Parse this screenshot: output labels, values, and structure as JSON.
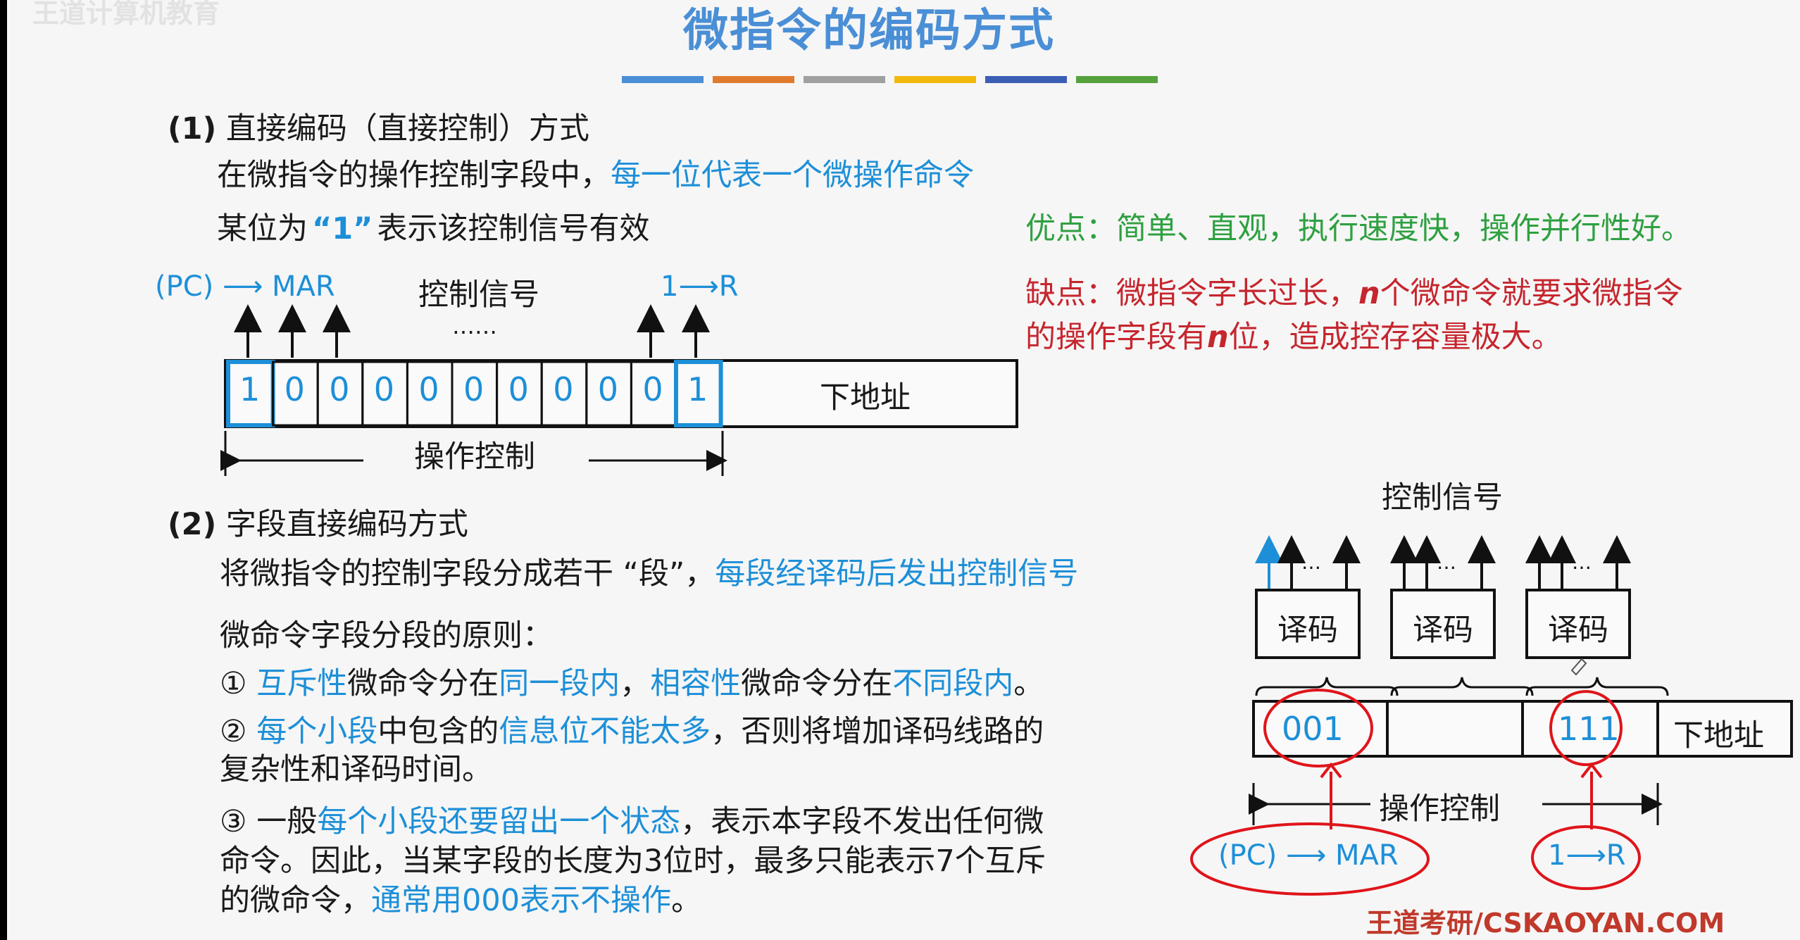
{
  "watermark": "王道计算机教育",
  "title": "微指令的编码方式",
  "title_bar_colors": [
    "#4a8fd6",
    "#e07b2e",
    "#a0a0a0",
    "#f2b90c",
    "#3c5fb5",
    "#55a23c"
  ],
  "section1": {
    "heading_num": "(1)",
    "heading": "直接编码（直接控制）方式",
    "line1_prefix": "在微指令的操作控制字段中，",
    "line1_highlight": "每一位代表一个微操作命令",
    "line2_a": "某位为",
    "line2_quote": "“1”",
    "line2_b": "表示该控制信号有效",
    "pros": "优点：简单、直观，执行速度快，操作并行性好。",
    "cons_a": "缺点：微指令字长过长，",
    "cons_n1": "n",
    "cons_b": "个微命令就要求微指令",
    "cons_c": "的操作字段有",
    "cons_n2": "n",
    "cons_d": "位，造成控存容量极大。"
  },
  "diagram1": {
    "pc_mar": "(PC) ⟶ MAR",
    "control_signal": "控制信号",
    "dots": "……",
    "one_r": "1⟶R",
    "bits": [
      "1",
      "0",
      "0",
      "0",
      "0",
      "0",
      "0",
      "0",
      "0",
      "0",
      "1"
    ],
    "next_address": "下地址",
    "operation_control": "操作控制"
  },
  "section2": {
    "heading_num": "(2)",
    "heading": "字段直接编码方式",
    "line1_prefix": "将微指令的控制字段分成若干 “段”，",
    "line1_highlight": "每段经译码后发出控制信号",
    "principle": "微命令字段分段的原则：",
    "p1": [
      {
        "text": "① ",
        "hl": false
      },
      {
        "text": "互斥性",
        "hl": true
      },
      {
        "text": "微命令分在",
        "hl": false
      },
      {
        "text": "同一段内",
        "hl": true
      },
      {
        "text": "，",
        "hl": false
      },
      {
        "text": "相容性",
        "hl": true
      },
      {
        "text": "微命令分在",
        "hl": false
      },
      {
        "text": "不同段内",
        "hl": true
      },
      {
        "text": "。",
        "hl": false
      }
    ],
    "p2a": [
      {
        "text": "② ",
        "hl": false
      },
      {
        "text": "每个小段",
        "hl": true
      },
      {
        "text": "中包含的",
        "hl": false
      },
      {
        "text": "信息位不能太多",
        "hl": true
      },
      {
        "text": "，否则将增加译码线路的",
        "hl": false
      }
    ],
    "p2b": "复杂性和译码时间。",
    "p3a": [
      {
        "text": "③ 一般",
        "hl": false
      },
      {
        "text": "每个小段还要留出一个状态",
        "hl": true
      },
      {
        "text": "，表示本字段不发出任何微",
        "hl": false
      }
    ],
    "p3b": "命令。因此，当某字段的长度为3位时，最多只能表示7个互斥",
    "p3c_a": "的微命令，",
    "p3c_hl": "通常用000表示不操作",
    "p3c_b": "。"
  },
  "diagram2": {
    "control_signal": "控制信号",
    "dots": "…",
    "decoder": "译码",
    "field1": "001",
    "field3": "111",
    "next_address": "下地址",
    "operation_control": "操作控制",
    "pc_mar": "(PC) ⟶ MAR",
    "one_r": "1⟶R"
  },
  "footer": "王道考研/CSKAOYAN.COM"
}
